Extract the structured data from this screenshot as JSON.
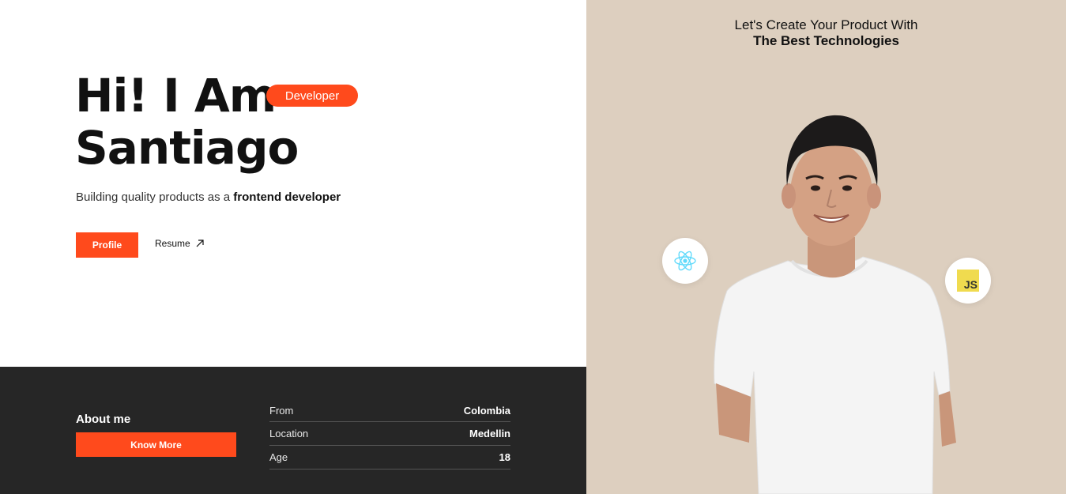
{
  "hero": {
    "title_line1": "Hi! I Am",
    "title_line2": "Santiago",
    "badge": "Developer",
    "subtitle_prefix": "Building quality products as a ",
    "subtitle_emphasis": "frontend developer",
    "profile_button": "Profile",
    "resume_link": "Resume"
  },
  "about": {
    "title": "About me",
    "button": "Know More",
    "rows": [
      {
        "label": "From",
        "value": "Colombia"
      },
      {
        "label": "Location",
        "value": "Medellin"
      },
      {
        "label": "Age",
        "value": "18"
      }
    ]
  },
  "showcase": {
    "heading_line1": "Let's Create Your Product With",
    "heading_line2": "The Best Technologies",
    "tech_icons": [
      "react-icon",
      "javascript-icon"
    ],
    "js_label": "JS"
  },
  "colors": {
    "accent": "#ff4a1c",
    "dark_panel": "#262626",
    "beige_panel": "#ddcfbf"
  }
}
